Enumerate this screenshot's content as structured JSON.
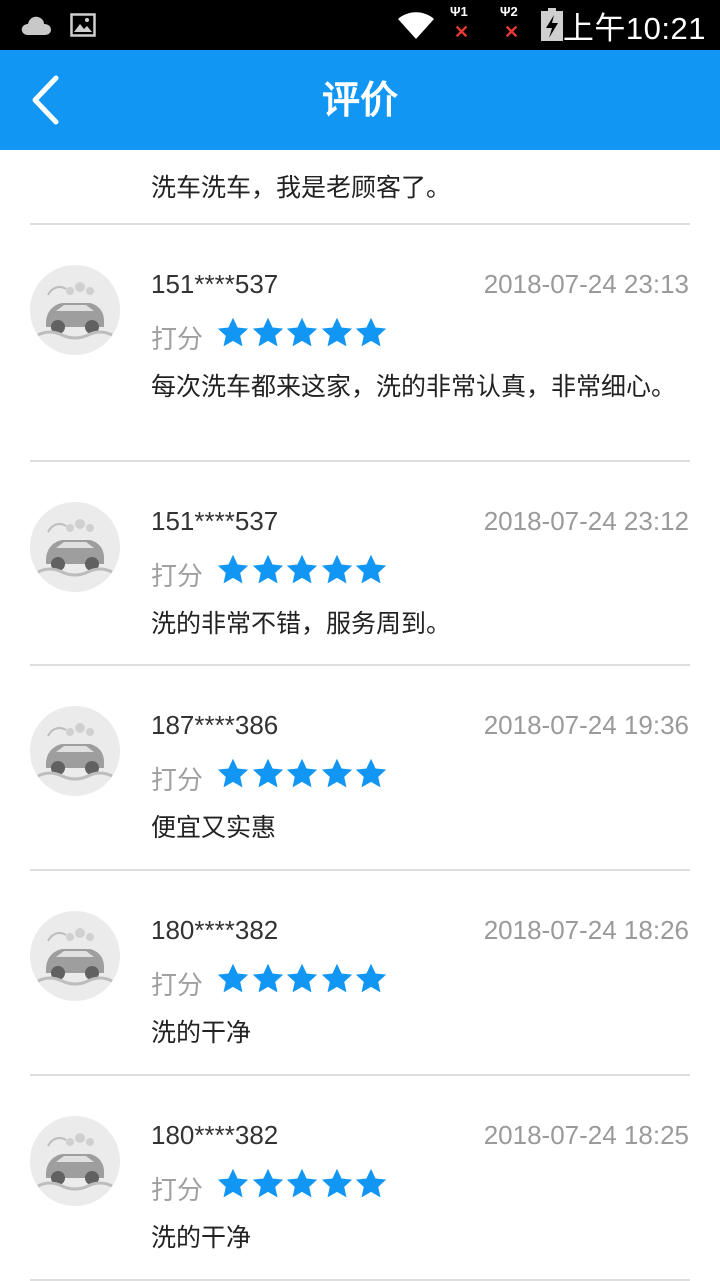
{
  "status_bar": {
    "time": "上午10:21",
    "sim1_label": "Ψ1",
    "sim2_label": "Ψ2",
    "no_signal_mark": "✕",
    "icons": [
      "cloud-icon",
      "image-icon",
      "wifi-icon",
      "sim1-signal-icon",
      "sim2-signal-icon",
      "battery-charging-icon"
    ]
  },
  "header": {
    "title": "评价",
    "back_icon": "chevron-left-icon",
    "color": "#1296f3"
  },
  "partial_review": {
    "content": "洗车洗车，我是老顾客了。"
  },
  "reviews": [
    {
      "user": "151****537",
      "date": "2018-07-24 23:13",
      "score_label": "打分",
      "rating": 5,
      "content": "每次洗车都来这家，洗的非常认真，非常细心。"
    },
    {
      "user": "151****537",
      "date": "2018-07-24 23:12",
      "score_label": "打分",
      "rating": 5,
      "content": "洗的非常不错，服务周到。"
    },
    {
      "user": "187****386",
      "date": "2018-07-24 19:36",
      "score_label": "打分",
      "rating": 5,
      "content": "便宜又实惠"
    },
    {
      "user": "180****382",
      "date": "2018-07-24 18:26",
      "score_label": "打分",
      "rating": 5,
      "content": "洗的干净"
    },
    {
      "user": "180****382",
      "date": "2018-07-24 18:25",
      "score_label": "打分",
      "rating": 5,
      "content": "洗的干净"
    }
  ],
  "star_color": "#1296f3"
}
